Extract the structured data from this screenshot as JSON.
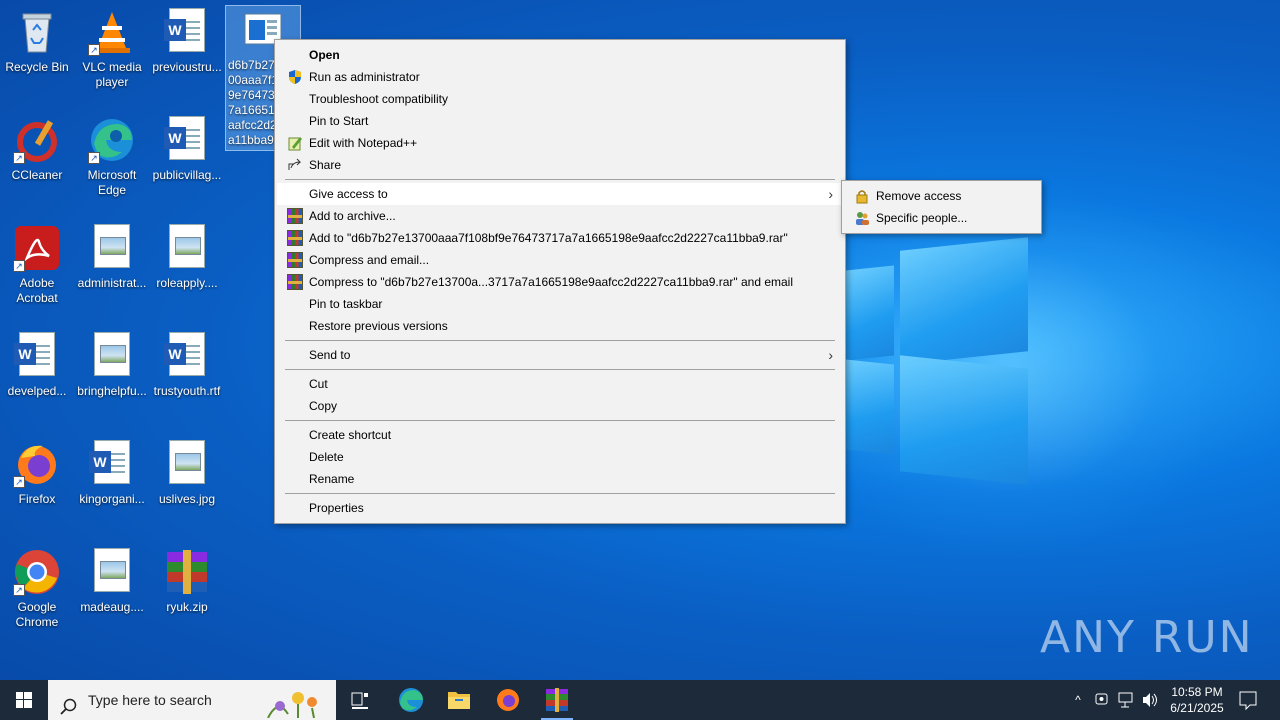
{
  "desktop": {
    "icons": [
      {
        "label": "Recycle Bin",
        "icon": "recycle-bin-icon"
      },
      {
        "label": "VLC media player",
        "icon": "vlc-icon"
      },
      {
        "label": "previoustru...",
        "icon": "word-doc-icon"
      },
      {
        "label": "d6b7b27e13700aaa7f108bf9e76473717a7a1665198e9aafcc2d2227ca11bba9",
        "icon": "file-icon"
      },
      {
        "label": "CCleaner",
        "icon": "ccleaner-icon"
      },
      {
        "label": "Microsoft Edge",
        "icon": "edge-icon"
      },
      {
        "label": "publicvillag...",
        "icon": "word-doc-icon"
      },
      {
        "label": "Adobe Acrobat",
        "icon": "acrobat-icon"
      },
      {
        "label": "administrat...",
        "icon": "image-file-icon"
      },
      {
        "label": "roleapply....",
        "icon": "image-file-icon"
      },
      {
        "label": "develped...",
        "icon": "word-doc-icon"
      },
      {
        "label": "bringhelpfu...",
        "icon": "image-file-icon"
      },
      {
        "label": "trustyouth.rtf",
        "icon": "word-doc-icon"
      },
      {
        "label": "Firefox",
        "icon": "firefox-icon"
      },
      {
        "label": "kingorgani...",
        "icon": "word-doc-icon"
      },
      {
        "label": "uslives.jpg",
        "icon": "image-file-icon"
      },
      {
        "label": "Google Chrome",
        "icon": "chrome-icon"
      },
      {
        "label": "madeaug....",
        "icon": "image-file-icon"
      },
      {
        "label": "ryuk.zip",
        "icon": "winrar-icon"
      }
    ],
    "selected_label_lines": [
      "d6b7b27",
      "00aaa7f1",
      "9e764737",
      "7a16651",
      "aafcc2d2",
      "a11bba9"
    ]
  },
  "context_menu": {
    "open": "Open",
    "run_as_admin": "Run as administrator",
    "troubleshoot": "Troubleshoot compatibility",
    "pin_start": "Pin to Start",
    "edit_notepad": "Edit with Notepad++",
    "share": "Share",
    "give_access": "Give access to",
    "add_archive": "Add to archive...",
    "add_to_rar": "Add to \"d6b7b27e13700aaa7f108bf9e76473717a7a1665198e9aafcc2d2227ca11bba9.rar\"",
    "compress_email": "Compress and email...",
    "compress_to_email": "Compress to \"d6b7b27e13700a...3717a7a1665198e9aafcc2d2227ca11bba9.rar\" and email",
    "pin_taskbar": "Pin to taskbar",
    "restore_versions": "Restore previous versions",
    "send_to": "Send to",
    "cut": "Cut",
    "copy": "Copy",
    "create_shortcut": "Create shortcut",
    "delete": "Delete",
    "rename": "Rename",
    "properties": "Properties"
  },
  "submenu": {
    "remove_access": "Remove access",
    "specific_people": "Specific people..."
  },
  "watermark": "ANY RUN",
  "taskbar": {
    "search_placeholder": "Type here to search",
    "time": "10:58 PM",
    "date": "6/21/2025"
  },
  "colors": {
    "taskbar": "#1d2a3a",
    "menu_bg": "#f2f2f2",
    "desktop_accent": "#0a78e0"
  }
}
